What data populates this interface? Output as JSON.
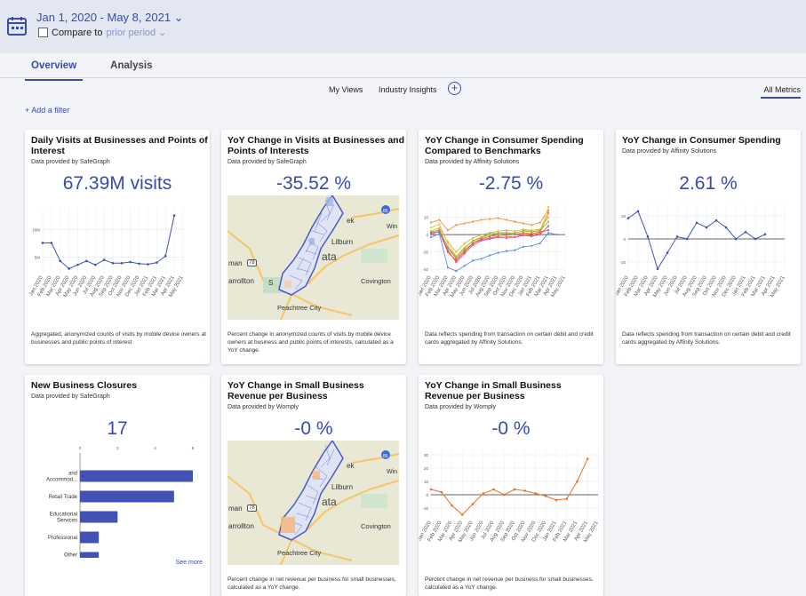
{
  "header": {
    "date_range": "Jan 1, 2020 - May 8, 2021 ⌄",
    "compare_label": "Compare to",
    "compare_period": "prior period ⌄"
  },
  "tabs": [
    {
      "label": "Overview",
      "active": true
    },
    {
      "label": "Analysis",
      "active": false
    }
  ],
  "subnav": {
    "my_views": "My Views",
    "industry_insights": "Industry Insights",
    "add": "+",
    "all_metrics": "All Metrics"
  },
  "filter": {
    "label": "+ Add a filter"
  },
  "colors": {
    "accent": "#3a4ab0",
    "orange": "#e8712a",
    "bar": "#4351b3"
  },
  "cards": [
    {
      "title": "Daily Visits at Businesses and Points of Interest",
      "provider": "Data provided by SafeGraph",
      "value": "67.39M visits",
      "desc": "Aggregated, anonymized counts of visits by mobile device owners at businesses and public points of interest"
    },
    {
      "title": "YoY Change in Visits at Businesses and Points of Interests",
      "provider": "Data provided by SafeGraph",
      "value": "-35.52 %",
      "desc": "Percent change in anonymized counts of visits by mobile device owners at business and public points of interests, calculated as a YoY change.",
      "map_labels": {
        "lilburn": "Lilburn",
        "ata": "ata",
        "win": "Win",
        "man": "man",
        "arrollton": "arrollton",
        "covington": "Covington",
        "peachtree": "Peachtree City",
        "ek": "ek",
        "s": "S",
        "hw78": "78"
      }
    },
    {
      "title": "YoY Change in Consumer Spending Compared to Benchmarks",
      "provider": "Data provided by Affinity Solutions",
      "value": "-2.75 %",
      "desc": "Data reflects spending from transaction on certain debit and credit cards aggregated by Affinity Solutions."
    },
    {
      "title": "YoY Change in Consumer Spending",
      "provider": "Data provided by Affinity Solutions",
      "value": "2.61 %",
      "desc": "Data reflects spending from transaction on certain debit and credit cards aggregated by Affinity Solutions."
    },
    {
      "title": "New Business Closures",
      "provider": "Data provided by SafeGraph",
      "value": "17",
      "see_more": "See more"
    },
    {
      "title": "YoY Change in Small Business Revenue per Business",
      "provider": "Data provided by Womply",
      "value": "-0 %",
      "desc": "Percent change in net revenue per business for small businesses, calculated as a YoY change."
    },
    {
      "title": "YoY Change in Small Business Revenue per Business",
      "provider": "Data provided by Womply",
      "value": "-0 %",
      "desc": "Percent change in net revenue per business for small businesses, calculated as a YoY change."
    }
  ],
  "months": [
    "Jan 2020",
    "Feb 2020",
    "Mar 2020",
    "Apr 2020",
    "May 2020",
    "Jun 2020",
    "Jul 2020",
    "Aug 2020",
    "Sep 2020",
    "Oct 2020",
    "Nov 2020",
    "Dec 2020",
    "Jan 2021",
    "Feb 2021",
    "Mar 2021",
    "Apr 2021",
    "May 2021"
  ],
  "chart_data": [
    {
      "type": "line",
      "title": "Daily Visits at Businesses and Points of Interest",
      "x": [
        "Jan 2020",
        "Feb 2020",
        "Mar 2020",
        "Apr 2020",
        "May 2020",
        "Jun 2020",
        "Jul 2020",
        "Aug 2020",
        "Sep 2020",
        "Oct 2020",
        "Nov 2020",
        "Dec 2020",
        "Jan 2021",
        "Feb 2021",
        "Mar 2021",
        "Apr 2021",
        "May 2021"
      ],
      "yticks": [
        "10M",
        "5M"
      ],
      "ylim": [
        2,
        14
      ],
      "series": [
        {
          "values": [
            7.6,
            7.6,
            4.3,
            2.9,
            3.6,
            4.3,
            3.6,
            4.5,
            3.9,
            3.9,
            4.1,
            3.8,
            3.7,
            4.0,
            5.2,
            12.6
          ]
        }
      ]
    },
    {
      "type": "line",
      "title": "YoY Change in Consumer Spending Compared to Benchmarks",
      "x": [
        "Jan 2020",
        "Feb 2020",
        "Mar 2020",
        "Apr 2020",
        "May 2020",
        "Jun 2020",
        "Jul 2020",
        "Aug 2020",
        "Sep 2020",
        "Oct 2020",
        "Nov 2020",
        "Dec 2020",
        "Jan 2021",
        "Feb 2021",
        "Mar 2021",
        "Apr 2021",
        "May 2021"
      ],
      "yticks": [
        "20",
        "0",
        "-20",
        "-40"
      ],
      "ylim": [
        -45,
        35
      ],
      "series": [
        {
          "values": [
            14,
            17,
            5,
            11,
            13,
            15,
            17,
            18,
            19,
            17,
            15,
            13,
            11,
            14,
            28
          ]
        },
        {
          "values": [
            8,
            12,
            -10,
            -25,
            -15,
            -8,
            -4,
            0,
            2,
            3,
            1,
            5,
            4,
            3,
            32
          ]
        },
        {
          "values": [
            2,
            6,
            -15,
            -28,
            -18,
            -10,
            -6,
            -4,
            -2,
            -2,
            -3,
            0,
            -1,
            2,
            25
          ]
        },
        {
          "values": [
            4,
            8,
            -8,
            -20,
            -10,
            -4,
            0,
            2,
            4,
            5,
            4,
            6,
            5,
            6,
            20
          ]
        },
        {
          "values": [
            3,
            5,
            -14,
            -26,
            -16,
            -7,
            -3,
            1,
            2,
            1,
            2,
            4,
            3,
            5,
            15
          ]
        },
        {
          "values": [
            0,
            4,
            -18,
            -32,
            -22,
            -12,
            -7,
            -5,
            -3,
            -4,
            -3,
            -1,
            -2,
            0,
            10
          ]
        },
        {
          "values": [
            2,
            3,
            -20,
            -30,
            -20,
            -10,
            -5,
            -2,
            0,
            1,
            0,
            2,
            1,
            3,
            5
          ]
        },
        {
          "values": [
            -3,
            1,
            -38,
            -42,
            -36,
            -30,
            -28,
            -24,
            -21,
            -19,
            -18,
            -14,
            -13,
            -10,
            2,
            0
          ]
        }
      ]
    },
    {
      "type": "line",
      "title": "YoY Change in Consumer Spending",
      "x": [
        "Jan 2020",
        "Feb 2020",
        "Mar 2020",
        "Apr 2020",
        "May 2020",
        "Jun 2020",
        "Jul 2020",
        "Aug 2020",
        "Sep 2020",
        "Oct 2020",
        "Nov 2020",
        "Dec 2020",
        "Jan 2021",
        "Feb 2021",
        "Mar 2021",
        "Apr 2021",
        "May 2021"
      ],
      "yticks": [
        "10",
        "0",
        "-10"
      ],
      "ylim": [
        -15,
        15
      ],
      "series": [
        {
          "values": [
            9,
            12,
            1,
            -13,
            -6,
            1,
            0,
            7,
            5,
            8,
            5,
            0,
            3,
            0,
            2
          ]
        }
      ]
    },
    {
      "type": "bar",
      "title": "New Business Closures",
      "orientation": "horizontal",
      "categories": [
        "and Accommod...",
        "Retail Trade",
        "Educational Services",
        "Professional",
        "Other Services..."
      ],
      "values": [
        6,
        5,
        2,
        1,
        1
      ],
      "xticks": [
        "0",
        "2",
        "4",
        "6"
      ],
      "xlim": [
        0,
        6
      ]
    },
    {
      "type": "line",
      "title": "YoY Change in Small Business Revenue per Business",
      "x": [
        "Jan 2020",
        "Feb 2020",
        "Mar 2020",
        "Apr 2020",
        "May 2020",
        "Jun 2020",
        "Jul 2020",
        "Aug 2020",
        "Sep 2020",
        "Oct 2020",
        "Nov 2020",
        "Dec 2020",
        "Jan 2021",
        "Feb 2021",
        "Mar 2021",
        "Apr 2021",
        "May 2021"
      ],
      "yticks": [
        "30",
        "20",
        "10",
        "0",
        "-10"
      ],
      "ylim": [
        -18,
        34
      ],
      "series": [
        {
          "values": [
            4,
            2,
            -8,
            -15,
            -7,
            1,
            4,
            0,
            4,
            3,
            1,
            -1,
            -4,
            -3,
            10,
            27
          ]
        }
      ]
    }
  ]
}
